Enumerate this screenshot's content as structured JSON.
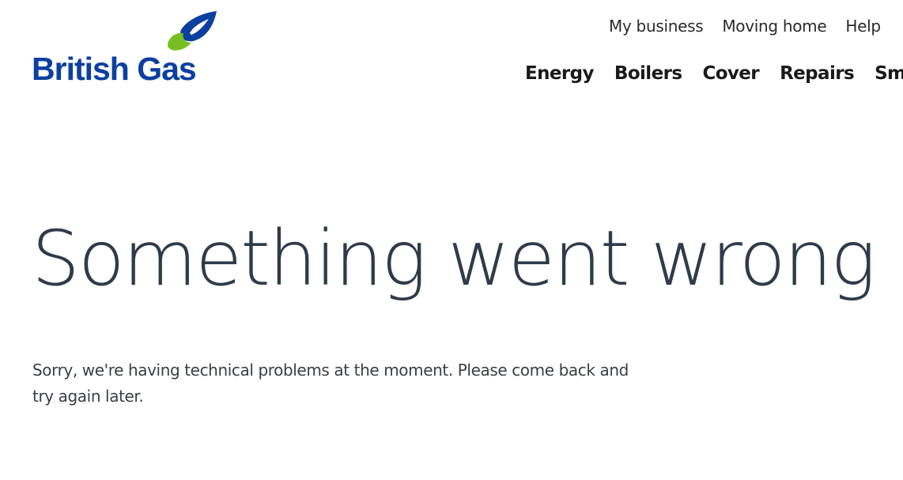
{
  "brand": {
    "name": "British Gas",
    "primary_color": "#0c3fa0",
    "accent_color": "#78be20",
    "logo_icon": "flame-icon"
  },
  "utility_nav": {
    "items": [
      "My business",
      "Moving home",
      "Help"
    ]
  },
  "main_nav": {
    "items": [
      "Energy",
      "Boilers",
      "Cover",
      "Repairs",
      "Sm"
    ]
  },
  "error": {
    "title": "Something went wrong",
    "message": "Sorry, we're having technical problems at the moment. Please come back and try again later."
  }
}
